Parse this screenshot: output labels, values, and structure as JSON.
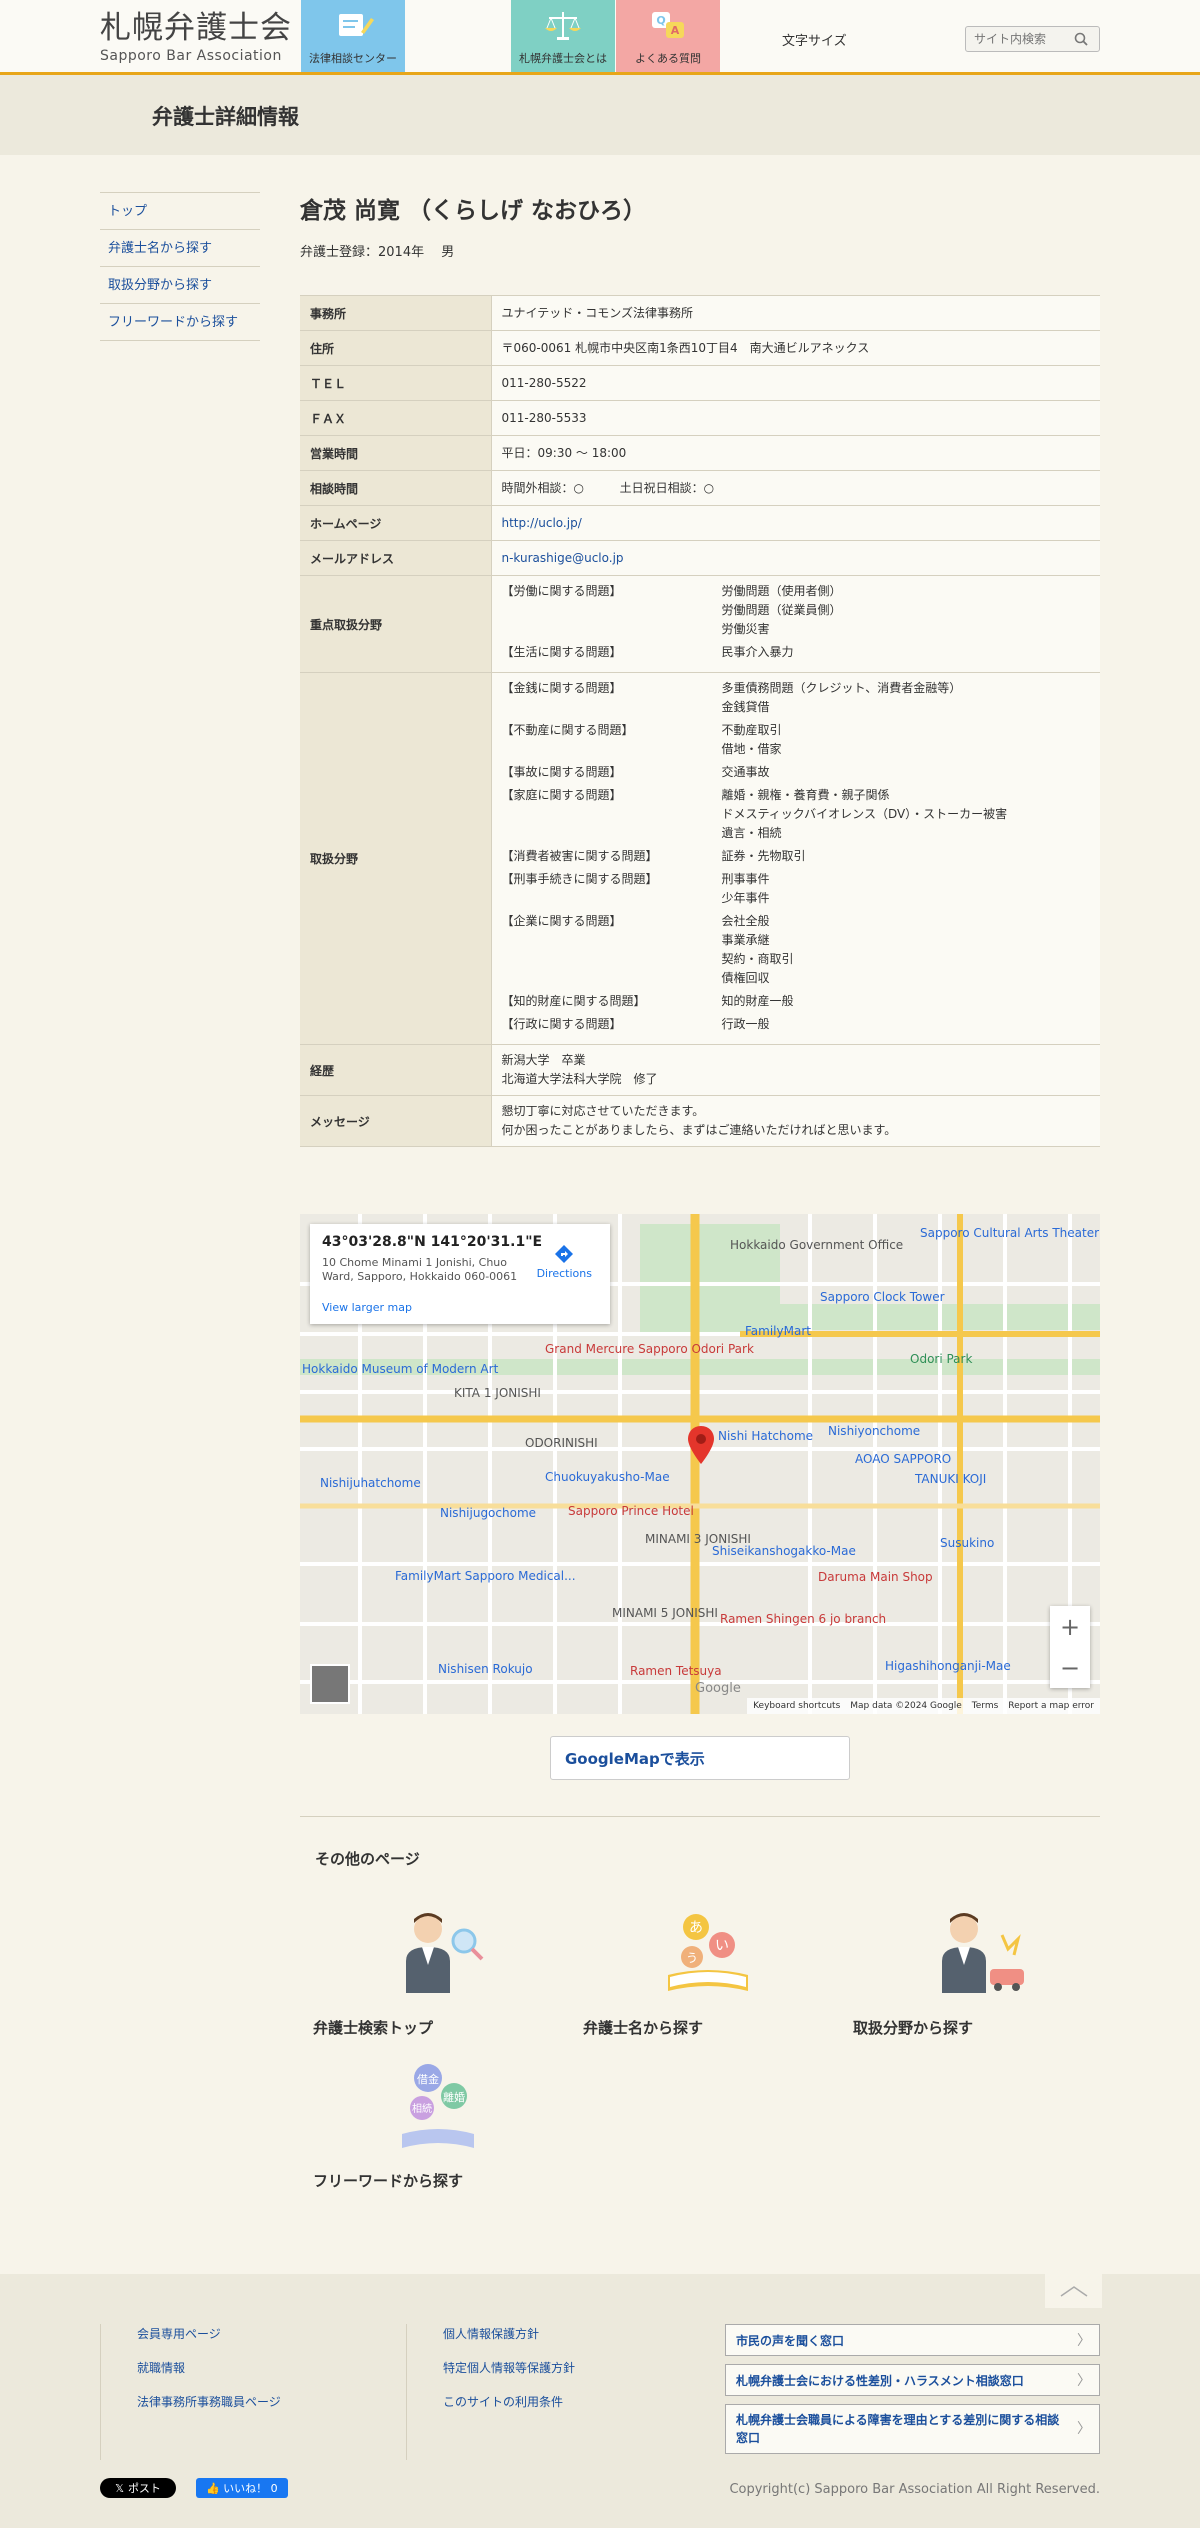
{
  "header": {
    "logo_ja": "札幌弁護士会",
    "logo_en": "Sapporo Bar Association",
    "nav_tiles": [
      {
        "label": "法律相談センター"
      },
      {
        "label": "札幌弁護士会とは"
      },
      {
        "label": "よくある質問"
      }
    ],
    "font_size_label": "文字サイズ",
    "search_placeholder": "サイト内検索"
  },
  "page_title": "弁護士詳細情報",
  "sidebar": {
    "items": [
      {
        "label": "トップ"
      },
      {
        "label": "弁護士名から探す"
      },
      {
        "label": "取扱分野から探す"
      },
      {
        "label": "フリーワードから探す"
      }
    ]
  },
  "lawyer": {
    "name": "倉茂 尚寛 （くらしげ なおひろ）",
    "meta": "弁護士登録：2014年　 男"
  },
  "info": {
    "office_label": "事務所",
    "office": "ユナイテッド・コモンズ法律事務所",
    "address_label": "住所",
    "address": "〒060-0061 札幌市中央区南1条西10丁目4　南大通ビルアネックス",
    "tel_label": "ＴＥＬ",
    "tel": "011-280-5522",
    "fax_label": "ＦＡＸ",
    "fax": "011-280-5533",
    "hours_label": "営業時間",
    "hours": "平日：09:30 〜 18:00",
    "consult_label": "相談時間",
    "consult_offhours": "時間外相談：○",
    "consult_weekend": "土日祝日相談：○",
    "homepage_label": "ホームページ",
    "homepage": "http://uclo.jp/",
    "email_label": "メールアドレス",
    "email": "n-kurashige@uclo.jp",
    "focus_label": "重点取扱分野",
    "focus": [
      {
        "category": "【労働に関する問題】",
        "items": [
          "労働問題（使用者側）",
          "労働問題（従業員側）",
          "労働災害"
        ]
      },
      {
        "category": "【生活に関する問題】",
        "items": [
          "民事介入暴力"
        ]
      }
    ],
    "areas_label": "取扱分野",
    "areas": [
      {
        "category": "【金銭に関する問題】",
        "items": [
          "多重債務問題（クレジット、消費者金融等）",
          "金銭貸借"
        ]
      },
      {
        "category": "【不動産に関する問題】",
        "items": [
          "不動産取引",
          "借地・借家"
        ]
      },
      {
        "category": "【事故に関する問題】",
        "items": [
          "交通事故"
        ]
      },
      {
        "category": "【家庭に関する問題】",
        "items": [
          "離婚・親権・養育費・親子関係",
          "ドメスティックバイオレンス（DV）・ストーカー被害",
          "遺言・相続"
        ]
      },
      {
        "category": "【消費者被害に関する問題】",
        "items": [
          "証券・先物取引"
        ]
      },
      {
        "category": "【刑事手続きに関する問題】",
        "items": [
          "刑事事件",
          "少年事件"
        ]
      },
      {
        "category": "【企業に関する問題】",
        "items": [
          "会社全般",
          "事業承継",
          "契約・商取引",
          "債権回収"
        ]
      },
      {
        "category": "【知的財産に関する問題】",
        "items": [
          "知的財産一般"
        ]
      },
      {
        "category": "【行政に関する問題】",
        "items": [
          "行政一般"
        ]
      }
    ],
    "career_label": "経歴",
    "career": [
      "新潟大学　卒業",
      "北海道大学法科大学院　修了"
    ],
    "message_label": "メッセージ",
    "message": [
      "懇切丁寧に対応させていただきます。",
      "何か困ったことがありましたら、まずはご連絡いただければと思います。"
    ]
  },
  "map": {
    "coord": "43°03'28.8\"N 141°20'31.1\"E",
    "address": "10 Chome Minami 1 Jonishi, Chuo Ward, Sapporo, Hokkaido 060-0061",
    "directions": "Directions",
    "view_larger": "View larger map",
    "labels": [
      {
        "text": "Hokkaido Government Office",
        "style": "normal"
      },
      {
        "text": "Sapporo Cultural Arts Theater",
        "style": "blue"
      },
      {
        "text": "Sapporo Clock Tower",
        "style": "blue"
      },
      {
        "text": "Grand Mercure Sapporo Odori Park",
        "style": "red"
      },
      {
        "text": "Hokkaido Museum of Modern Art",
        "style": "blue"
      },
      {
        "text": "KITA 1 JONISHI",
        "style": "normal"
      },
      {
        "text": "FamilyMart",
        "style": "blue"
      },
      {
        "text": "Odori Park",
        "style": "green"
      },
      {
        "text": "ODORINISHI",
        "style": "normal"
      },
      {
        "text": "Nishi Hatchome",
        "style": "blue"
      },
      {
        "text": "Nishiyonchome",
        "style": "blue"
      },
      {
        "text": "AOAO SAPPORO",
        "style": "blue"
      },
      {
        "text": "Nishijuhatchome",
        "style": "blue"
      },
      {
        "text": "Chuokuyakusho-Mae",
        "style": "blue"
      },
      {
        "text": "TANUKI KOJI",
        "style": "blue"
      },
      {
        "text": "Sapporo Prince Hotel",
        "style": "red"
      },
      {
        "text": "Nishijugochome",
        "style": "blue"
      },
      {
        "text": "MINAMI 3 JONISHI",
        "style": "normal"
      },
      {
        "text": "Shiseikanshogakko-Mae",
        "style": "blue"
      },
      {
        "text": "Susukino",
        "style": "blue"
      },
      {
        "text": "FamilyMart Sapporo Medical...",
        "style": "blue"
      },
      {
        "text": "Daruma Main Shop",
        "style": "red"
      },
      {
        "text": "MINAMI 5 JONISHI",
        "style": "normal"
      },
      {
        "text": "Ramen Shingen 6 jo branch",
        "style": "red"
      },
      {
        "text": "Nishisen Rokujo",
        "style": "blue"
      },
      {
        "text": "Ramen Tetsuya",
        "style": "red"
      },
      {
        "text": "Higashihonganji-Mae",
        "style": "blue"
      }
    ],
    "footer": [
      "Keyboard shortcuts",
      "Map data ©2024 Google",
      "Terms",
      "Report a map error"
    ],
    "google": "Google"
  },
  "gmap_button": "GoogleMapで表示",
  "other_pages": {
    "title": "その他のページ",
    "links": [
      {
        "label": "弁護士検索トップ"
      },
      {
        "label": "弁護士名から探す"
      },
      {
        "label": "取扱分野から探す"
      },
      {
        "label": "フリーワードから探す"
      }
    ]
  },
  "footer": {
    "col1": [
      "会員専用ページ",
      "就職情報",
      "法律事務所事務職員ページ"
    ],
    "col2": [
      "個人情報保護方針",
      "特定個人情報等保護方針",
      "このサイトの利用条件"
    ],
    "boxes": [
      "市民の声を聞く窓口",
      "札幌弁護士会における性差別・ハラスメント相談窓口",
      "札幌弁護士会職員による障害を理由とする差別に関する相談窓口"
    ],
    "x_post": "ポスト",
    "fb_like": "いいね！ 0",
    "copyright": "Copyright(c) Sapporo Bar Association All Right Reserved."
  },
  "colors": {
    "accent": "#e8a619",
    "link": "#1b4f9c",
    "bg": "#f7f4ea",
    "tile_blue": "#7fc6eb",
    "tile_teal": "#7fd0c4",
    "tile_pink": "#f3a7a4"
  }
}
